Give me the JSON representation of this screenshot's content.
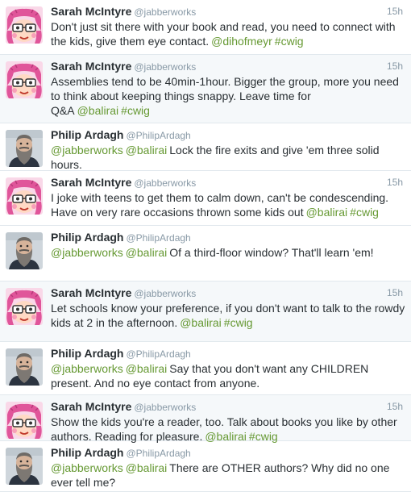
{
  "tweets": [
    {
      "author": "sarah",
      "name": "Sarah McIntyre",
      "handle": "@jabberworks",
      "time": "15h",
      "shade": false,
      "segments": [
        {
          "t": "Don't just sit there with your book and read, you need to connect with the kids, give them eye contact.",
          "link": false
        },
        {
          "t": "@dihofmeyr",
          "link": true
        },
        {
          "t": "#cwig",
          "link": true
        }
      ]
    },
    {
      "author": "sarah",
      "name": "Sarah McIntyre",
      "handle": "@jabberworks",
      "time": "15h",
      "shade": true,
      "segments": [
        {
          "t": "Assemblies tend to be 40min-1hour. Bigger the group, more you need to think about keeping things snappy. Leave time for Q&A",
          "link": false
        },
        {
          "t": "@balirai",
          "link": true
        },
        {
          "t": "#cwig",
          "link": true
        }
      ]
    },
    {
      "author": "philip",
      "name": "Philip Ardagh",
      "handle": "@PhilipArdagh",
      "time": "",
      "shade": false,
      "segments": [
        {
          "t": "@jabberworks",
          "link": true
        },
        {
          "t": "@balirai",
          "link": true
        },
        {
          "t": "Lock the fire exits and give 'em three solid hours.",
          "link": false
        }
      ]
    },
    {
      "author": "sarah",
      "name": "Sarah McIntyre",
      "handle": "@jabberworks",
      "time": "15h",
      "shade": false,
      "segments": [
        {
          "t": "I joke with teens to get them to calm down, can't be condescending. Have on very rare occasions thrown some kids out",
          "link": false
        },
        {
          "t": "@balirai",
          "link": true
        },
        {
          "t": "#cwig",
          "link": true
        }
      ]
    },
    {
      "author": "philip",
      "name": "Philip Ardagh",
      "handle": "@PhilipArdagh",
      "time": "",
      "shade": false,
      "segments": [
        {
          "t": "@jabberworks",
          "link": true
        },
        {
          "t": "@balirai",
          "link": true
        },
        {
          "t": "Of a third-floor window? That'll learn 'em!",
          "link": false
        }
      ]
    },
    {
      "author": "sarah",
      "name": "Sarah McIntyre",
      "handle": "@jabberworks",
      "time": "15h",
      "shade": true,
      "segments": [
        {
          "t": "Let schools know your preference, if you don't want to talk to the rowdy kids at 2 in the afternoon.",
          "link": false
        },
        {
          "t": "@balirai",
          "link": true
        },
        {
          "t": "#cwig",
          "link": true
        }
      ]
    },
    {
      "author": "philip",
      "name": "Philip Ardagh",
      "handle": "@PhilipArdagh",
      "time": "",
      "shade": false,
      "segments": [
        {
          "t": "@jabberworks",
          "link": true
        },
        {
          "t": "@balirai",
          "link": true
        },
        {
          "t": "Say that you don't want any CHILDREN present. And no eye contact from anyone.",
          "link": false
        }
      ]
    },
    {
      "author": "sarah",
      "name": "Sarah McIntyre",
      "handle": "@jabberworks",
      "time": "15h",
      "shade": true,
      "segments": [
        {
          "t": "Show the kids you're a reader, too. Talk about books you like by other authors. Reading for pleasure.",
          "link": false
        },
        {
          "t": "@balirai",
          "link": true
        },
        {
          "t": "#cwig",
          "link": true
        }
      ]
    },
    {
      "author": "philip",
      "name": "Philip Ardagh",
      "handle": "@PhilipArdagh",
      "time": "",
      "shade": false,
      "segments": [
        {
          "t": "@jabberworks",
          "link": true
        },
        {
          "t": "@balirai",
          "link": true
        },
        {
          "t": "There are OTHER authors? Why did no one ever tell me?",
          "link": false
        }
      ]
    }
  ],
  "colors": {
    "link": "#669933",
    "meta": "#8899a6",
    "text": "#292f33",
    "shade": "#f5f8fa"
  },
  "icons": {
    "sarah": "cartoon-avatar-icon",
    "philip": "bearded-man-avatar-icon"
  }
}
